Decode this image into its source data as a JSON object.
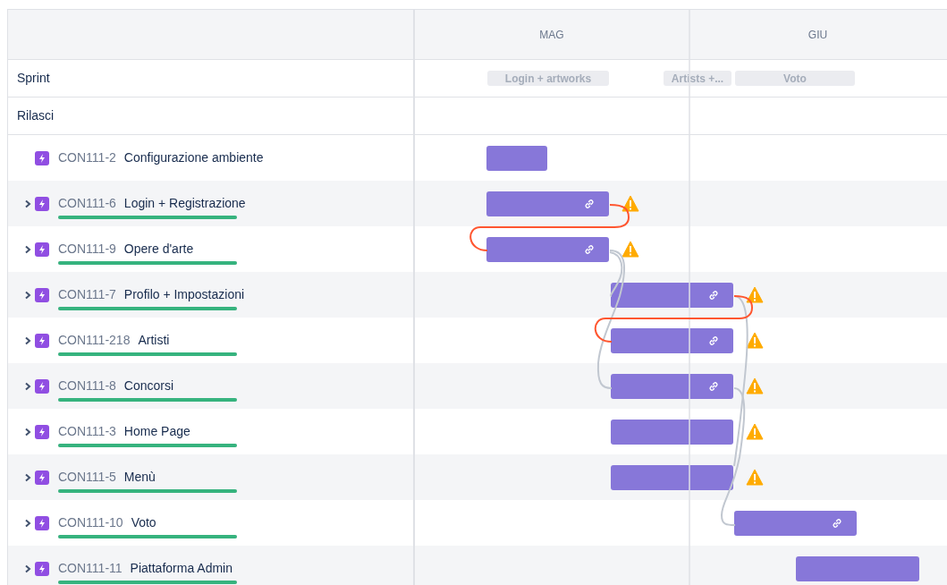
{
  "timeline": {
    "months": [
      "MAG",
      "GIU"
    ]
  },
  "sprint_row": {
    "label": "Sprint",
    "sprints": [
      "Login + artworks",
      "Artists +...",
      "Voto"
    ]
  },
  "releases_row": {
    "label": "Rilasci"
  },
  "issues": [
    {
      "key": "CON111-2",
      "title": "Configurazione ambiente",
      "expandable": false,
      "linked": false,
      "warning": false
    },
    {
      "key": "CON111-6",
      "title": "Login + Registrazione",
      "expandable": true,
      "level": 1,
      "linked": true,
      "warning": true
    },
    {
      "key": "CON111-9",
      "title": "Opere d'arte",
      "expandable": true,
      "level": 1,
      "linked": true,
      "warning": true
    },
    {
      "key": "CON111-7",
      "title": "Profilo + Impostazioni",
      "expandable": true,
      "level": 1,
      "linked": true,
      "warning": true
    },
    {
      "key": "CON111-218",
      "title": "Artisti",
      "expandable": true,
      "level": 1,
      "linked": true,
      "warning": true
    },
    {
      "key": "CON111-8",
      "title": "Concorsi",
      "expandable": true,
      "level": 1,
      "linked": true,
      "warning": true
    },
    {
      "key": "CON111-3",
      "title": "Home Page",
      "expandable": true,
      "level": 1,
      "linked": false,
      "warning": true
    },
    {
      "key": "CON111-5",
      "title": "Menù",
      "expandable": true,
      "level": 1,
      "linked": false,
      "warning": true
    },
    {
      "key": "CON111-10",
      "title": "Voto",
      "expandable": true,
      "level": 1,
      "linked": true,
      "warning": false
    },
    {
      "key": "CON111-11",
      "title": "Piattaforma Admin",
      "expandable": true,
      "level": 1,
      "linked": false,
      "warning": false
    }
  ]
}
